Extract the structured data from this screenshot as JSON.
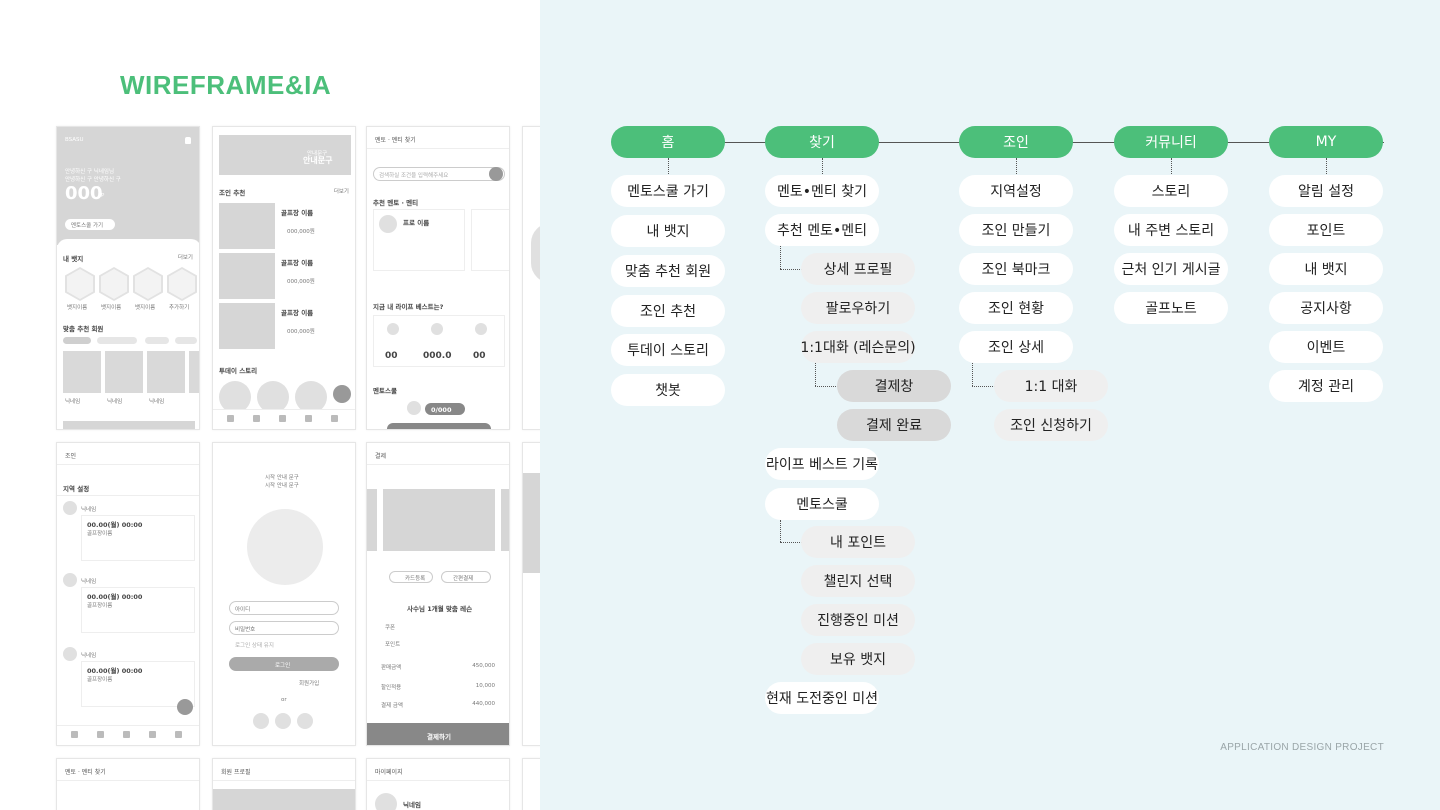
{
  "page": {
    "title": "WIREFRAME&IA",
    "footer": "APPLICATION DESIGN PROJECT"
  },
  "colors": {
    "accent": "#4cbf7a",
    "ia_background": "#eaf5f8"
  },
  "wireframes": {
    "home": {
      "brand": "BSASU",
      "greeting_line1": "안녕하신 구 닉네임님",
      "greeting_line2": "안녕하신 구 안녕하신 구",
      "points": "000",
      "points_unit": "P",
      "mentor_button": "멘토스쿨 가기",
      "my_badge": "내 뱃지",
      "more": "더보기",
      "badge_labels": [
        "뱃지이름",
        "뱃지이름",
        "뱃지이름",
        "추가하기"
      ],
      "recommend": "맞춤 추천 회원",
      "nick": "닉네임",
      "tab_home": "홈"
    },
    "join_list": {
      "banner_sub": "안내문구",
      "banner_main": "안내문구",
      "join_rec": "조인 추천",
      "more": "더보기",
      "golf_name": "골프장 이름",
      "price": "000,000원",
      "today_story": "투데이 스토리"
    },
    "mentor_find": {
      "header": "멘토 · 멘티 찾기",
      "search_placeholder": "검색하실 조건을 입력해주세요",
      "rec": "추천 멘토 · 멘티",
      "profile_name": "프로 이름",
      "life_best": "지금 내 라이프 베스트는?",
      "value1": "00",
      "value2": "000.0",
      "value3": "00",
      "mentor_school": "멘토스쿨",
      "pts": "0/000"
    },
    "join_page": {
      "header": "조인",
      "region": "지역 설정",
      "datetime": "00.00(월) 00:00",
      "golf": "골프장이름",
      "nick": "닉네임"
    },
    "login": {
      "intro1": "시작 안내 문구",
      "intro2": "시작 안내 문구",
      "id_placeholder": "아이디",
      "pw_placeholder": "비밀번호",
      "auto_login": "로그인 상태 유지",
      "login_button": "로그인",
      "signup": "회원가입",
      "or": "or"
    },
    "payment": {
      "header": "결제",
      "card_register": "카드등록",
      "simple_pay": "간편결제",
      "lesson": "사수님 1개월 맞춤 레슨",
      "coupon": "쿠폰",
      "points": "포인트",
      "amount_label": "판매금액",
      "amount": "450,000",
      "discount_label": "할인적용",
      "discount": "10,000",
      "total_label": "결제 금액",
      "total": "440,000",
      "pay_button": "결제하기"
    },
    "mentor_find2": {
      "header": "멘토 · 멘티 찾기"
    },
    "member_profile": {
      "header": "회원 프로필"
    },
    "mypage": {
      "header": "마이페이지",
      "nick": "닉네임"
    }
  },
  "ia": {
    "columns": [
      {
        "header": "홈",
        "items": [
          {
            "label": "멘토스쿨 가기",
            "level": 1
          },
          {
            "label": "내 뱃지",
            "level": 1
          },
          {
            "label": "맞춤 추천 회원",
            "level": 1
          },
          {
            "label": "조인 추천",
            "level": 1
          },
          {
            "label": "투데이 스토리",
            "level": 1
          },
          {
            "label": "챗봇",
            "level": 1
          }
        ]
      },
      {
        "header": "찾기",
        "items": [
          {
            "label": "멘토•멘티 찾기",
            "level": 1
          },
          {
            "label": "추천 멘토•멘티",
            "level": 1
          },
          {
            "label": "상세 프로필",
            "level": 2
          },
          {
            "label": "팔로우하기",
            "level": 2
          },
          {
            "label": "1:1대화 (레슨문의)",
            "level": 2
          },
          {
            "label": "결제창",
            "level": 3
          },
          {
            "label": "결제 완료",
            "level": 3
          },
          {
            "label": "라이프 베스트 기록",
            "level": 1
          },
          {
            "label": "멘토스쿨",
            "level": 1
          },
          {
            "label": "내 포인트",
            "level": 2
          },
          {
            "label": "챌린지 선택",
            "level": 2
          },
          {
            "label": "진행중인 미션",
            "level": 2
          },
          {
            "label": "보유 뱃지",
            "level": 2
          },
          {
            "label": "현재 도전중인 미션",
            "level": 1
          }
        ]
      },
      {
        "header": "조인",
        "items": [
          {
            "label": "지역설정",
            "level": 1
          },
          {
            "label": "조인 만들기",
            "level": 1
          },
          {
            "label": "조인 북마크",
            "level": 1
          },
          {
            "label": "조인 현황",
            "level": 1
          },
          {
            "label": "조인 상세",
            "level": 1
          },
          {
            "label": "1:1 대화",
            "level": 2
          },
          {
            "label": "조인 신청하기",
            "level": 2
          }
        ]
      },
      {
        "header": "커뮤니티",
        "items": [
          {
            "label": "스토리",
            "level": 1
          },
          {
            "label": "내 주변 스토리",
            "level": 1
          },
          {
            "label": "근처 인기 게시글",
            "level": 1
          },
          {
            "label": "골프노트",
            "level": 1
          }
        ]
      },
      {
        "header": "MY",
        "items": [
          {
            "label": "알림 설정",
            "level": 1
          },
          {
            "label": "포인트",
            "level": 1
          },
          {
            "label": "내 뱃지",
            "level": 1
          },
          {
            "label": "공지사항",
            "level": 1
          },
          {
            "label": "이벤트",
            "level": 1
          },
          {
            "label": "계정 관리",
            "level": 1
          }
        ]
      }
    ]
  }
}
